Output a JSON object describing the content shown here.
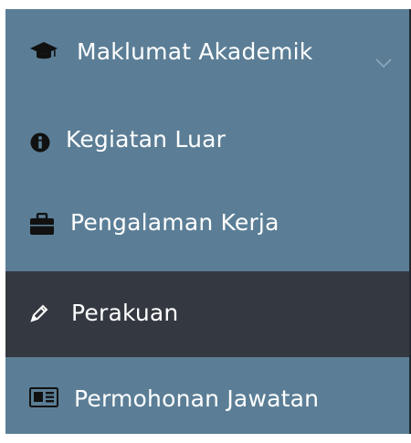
{
  "sidebar": {
    "items": [
      {
        "label": "Maklumat Akademik",
        "icon": "graduation-cap-icon",
        "expandable": true
      },
      {
        "label": "Kegiatan Luar",
        "icon": "info-icon"
      },
      {
        "label": "Pengalaman Kerja",
        "icon": "briefcase-icon"
      },
      {
        "label": "Perakuan",
        "icon": "pencil-icon",
        "active": true
      },
      {
        "label": "Permohonan Jawatan",
        "icon": "id-card-icon"
      }
    ]
  },
  "colors": {
    "menu_bg": "#5b7e96",
    "active_bg": "#343840",
    "text": "#ffffff",
    "chevron": "#8fa9bb"
  }
}
